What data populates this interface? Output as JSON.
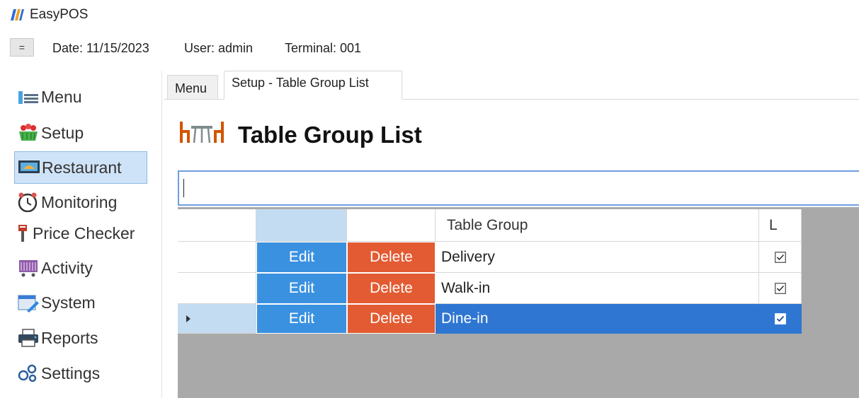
{
  "app": {
    "title": "EasyPOS",
    "logo_icon": "easypos-logo-icon"
  },
  "infobar": {
    "toggle_label": "=",
    "date": "Date: 11/15/2023",
    "user": "User: admin",
    "terminal": "Terminal: 001"
  },
  "sidebar": {
    "items": [
      {
        "label": "Menu",
        "icon": "menu-icon"
      },
      {
        "label": "Setup",
        "icon": "setup-basket-icon"
      },
      {
        "label": "Restaurant",
        "icon": "restaurant-icon",
        "active": true
      },
      {
        "label": "Monitoring",
        "icon": "monitoring-clock-icon"
      },
      {
        "label": "Price Checker",
        "icon": "price-tag-icon"
      },
      {
        "label": "Activity",
        "icon": "activity-cart-icon"
      },
      {
        "label": "System",
        "icon": "system-icon"
      },
      {
        "label": "Reports",
        "icon": "printer-icon"
      },
      {
        "label": "Settings",
        "icon": "gears-icon"
      }
    ]
  },
  "tabs": [
    {
      "label": "Menu",
      "active": false
    },
    {
      "label": "Setup - Table Group List",
      "active": true
    }
  ],
  "page": {
    "title": "Table Group List",
    "icon": "table-chairs-icon"
  },
  "search": {
    "value": ""
  },
  "grid": {
    "columns": [
      "",
      "",
      "",
      "Table Group",
      "L"
    ],
    "rows": [
      {
        "edit": "Edit",
        "delete": "Delete",
        "table_group": "Delivery",
        "locked": true,
        "selected": false
      },
      {
        "edit": "Edit",
        "delete": "Delete",
        "table_group": "Walk-in",
        "locked": true,
        "selected": false
      },
      {
        "edit": "Edit",
        "delete": "Delete",
        "table_group": "Dine-in",
        "locked": true,
        "selected": true
      }
    ]
  },
  "colors": {
    "edit_button": "#3a91e0",
    "delete_button": "#e35b32",
    "selected_row": "#2f76d2",
    "active_nav": "#cfe3f8",
    "grid_empty_area": "#a9a9a9"
  }
}
